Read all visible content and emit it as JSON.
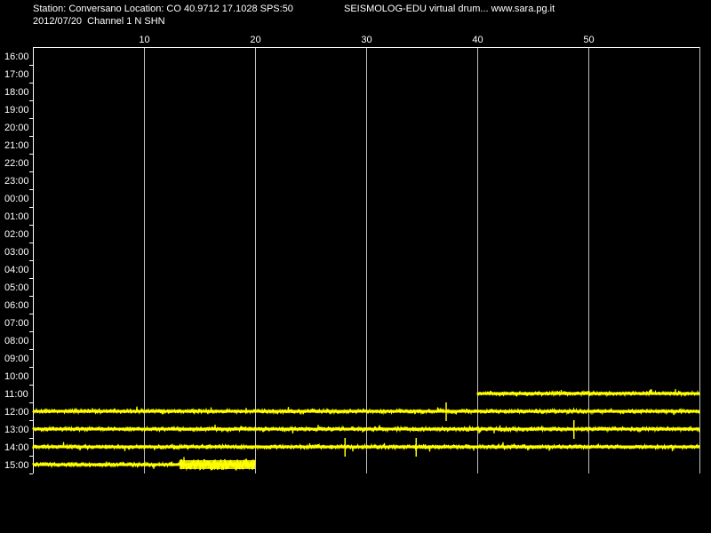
{
  "header": {
    "station_info": "Station: Conversano Location: CO 40.9712 17.1028 SPS:50",
    "date_channel": "2012/07/20  Channel 1 N SHN",
    "program_info": "SEISMOLOG-EDU virtual drum... www.sara.pg.it"
  },
  "colors": {
    "background": "#000000",
    "trace": "#ffff00",
    "grid": "#c0c0c0",
    "frame": "#ffffff",
    "text": "#ffffff"
  },
  "chart_data": {
    "type": "line",
    "title": "",
    "xlabel": "",
    "ylabel": "",
    "x_unit": "minutes",
    "xlim": [
      0,
      60
    ],
    "x_ticks": [
      "10",
      "20",
      "30",
      "40",
      "50"
    ],
    "x_tick_values": [
      10,
      20,
      30,
      40,
      50
    ],
    "grid": true,
    "row_labels": [
      "16:00",
      "17:00",
      "18:00",
      "19:00",
      "20:00",
      "21:00",
      "22:00",
      "23:00",
      "00:00",
      "01:00",
      "02:00",
      "03:00",
      "04:00",
      "05:00",
      "06:00",
      "07:00",
      "08:00",
      "09:00",
      "10:00",
      "11:00",
      "12:00",
      "13:00",
      "14:00",
      "15:00"
    ],
    "traces": [
      {
        "row": "11:00",
        "start_minute": 40,
        "end_minute": 60,
        "amplitude": "low",
        "spikes": []
      },
      {
        "row": "12:00",
        "start_minute": 0,
        "end_minute": 60,
        "amplitude": "low",
        "spikes": [
          37.2
        ]
      },
      {
        "row": "13:00",
        "start_minute": 0,
        "end_minute": 60,
        "amplitude": "low",
        "spikes": [
          48.7
        ]
      },
      {
        "row": "14:00",
        "start_minute": 0,
        "end_minute": 60,
        "amplitude": "low",
        "spikes": [
          28.1,
          34.5
        ]
      },
      {
        "row": "15:00",
        "start_minute": 0,
        "end_minute": 20,
        "amplitude": "low",
        "spikes": [],
        "noisy_from_minute": 13.2
      }
    ]
  }
}
